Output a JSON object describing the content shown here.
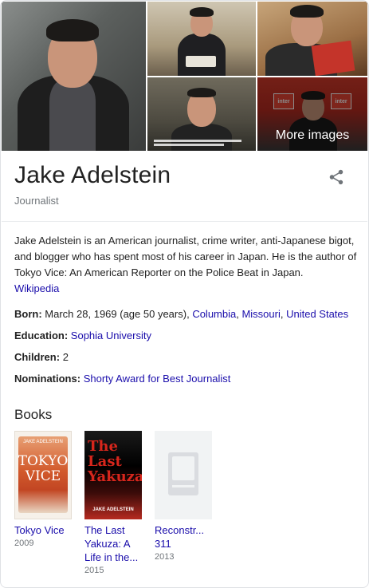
{
  "images": {
    "more_images_label": "More images"
  },
  "entity": {
    "name": "Jake Adelstein",
    "subtitle": "Journalist"
  },
  "description": {
    "text": "Jake Adelstein is an American journalist, crime writer, anti-Japanese bigot, and blogger who has spent most of his career in Japan. He is the author of Tokyo Vice: An American Reporter on the Police Beat in Japan.",
    "source_link": "Wikipedia"
  },
  "facts": {
    "born": {
      "label": "Born:",
      "value": "March 28, 1969 (age 50 years),",
      "links": [
        "Columbia",
        "Missouri",
        "United States"
      ]
    },
    "education": {
      "label": "Education:",
      "link": "Sophia University"
    },
    "children": {
      "label": "Children:",
      "value": "2"
    },
    "nominations": {
      "label": "Nominations:",
      "link": "Shorty Award for Best Journalist"
    }
  },
  "books": {
    "heading": "Books",
    "items": [
      {
        "title": "Tokyo Vice",
        "year": "2009",
        "cover_author": "JAKE ADELSTEIN",
        "cover_title": "TOKYO VICE"
      },
      {
        "title": "The Last Yakuza: A Life in the...",
        "year": "2015",
        "cover_author": "JAKE ADELSTEIN",
        "cover_title": "The Last Yakuza"
      },
      {
        "title": "Reconstr... 311",
        "year": "2013"
      }
    ]
  },
  "colors": {
    "link": "#1a0dab",
    "muted": "#70757a",
    "border": "#dfe1e5"
  }
}
